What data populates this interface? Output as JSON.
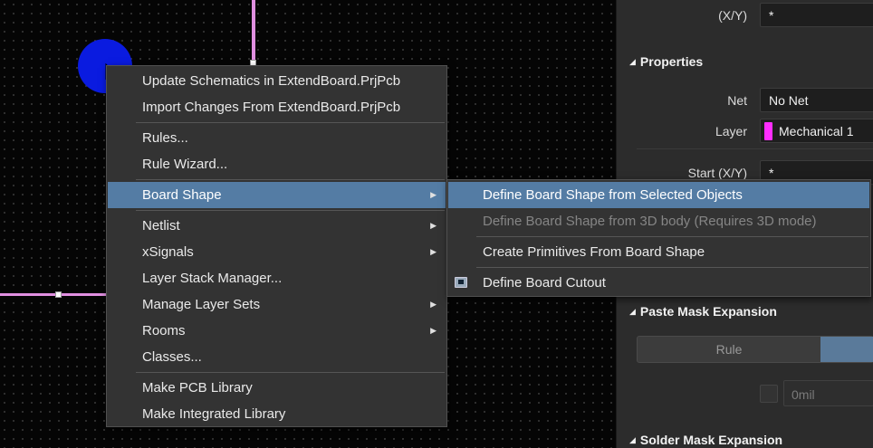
{
  "panel": {
    "xy_label": "(X/Y)",
    "xy_value": "*",
    "properties_title": "Properties",
    "net_label": "Net",
    "net_value": "No Net",
    "layer_label": "Layer",
    "layer_value": "Mechanical 1",
    "layer_color": "#ff2dff",
    "start_label": "Start (X/Y)",
    "start_value": "*",
    "paste_mask_title": "Paste Mask Expansion",
    "paste_mask_rule_label": "Rule",
    "paste_mask_value": "0mil",
    "solder_mask_title": "Solder Mask Expansion"
  },
  "context_menu": {
    "items": [
      {
        "label": "Update Schematics in ExtendBoard.PrjPcb"
      },
      {
        "label": "Import Changes From ExtendBoard.PrjPcb"
      },
      {
        "label": "Rules..."
      },
      {
        "label": "Rule Wizard..."
      },
      {
        "label": "Board Shape",
        "submenu": true,
        "highlighted": true
      },
      {
        "label": "Netlist",
        "submenu": true
      },
      {
        "label": "xSignals",
        "submenu": true
      },
      {
        "label": "Layer Stack Manager..."
      },
      {
        "label": "Manage Layer Sets",
        "submenu": true
      },
      {
        "label": "Rooms",
        "submenu": true
      },
      {
        "label": "Classes..."
      },
      {
        "label": "Make PCB Library"
      },
      {
        "label": "Make Integrated Library"
      }
    ]
  },
  "submenu": {
    "items": [
      {
        "label": "Define Board Shape from Selected Objects",
        "highlighted": true
      },
      {
        "label": "Define Board Shape from 3D body (Requires 3D mode)",
        "disabled": true
      },
      {
        "label": "Create Primitives From Board Shape"
      },
      {
        "label": "Define Board Cutout",
        "icon": "board-cutout-icon"
      }
    ]
  },
  "colors": {
    "highlight": "#547ca4",
    "trace": "#e08fe0",
    "click_marker": "#0a1be0"
  }
}
